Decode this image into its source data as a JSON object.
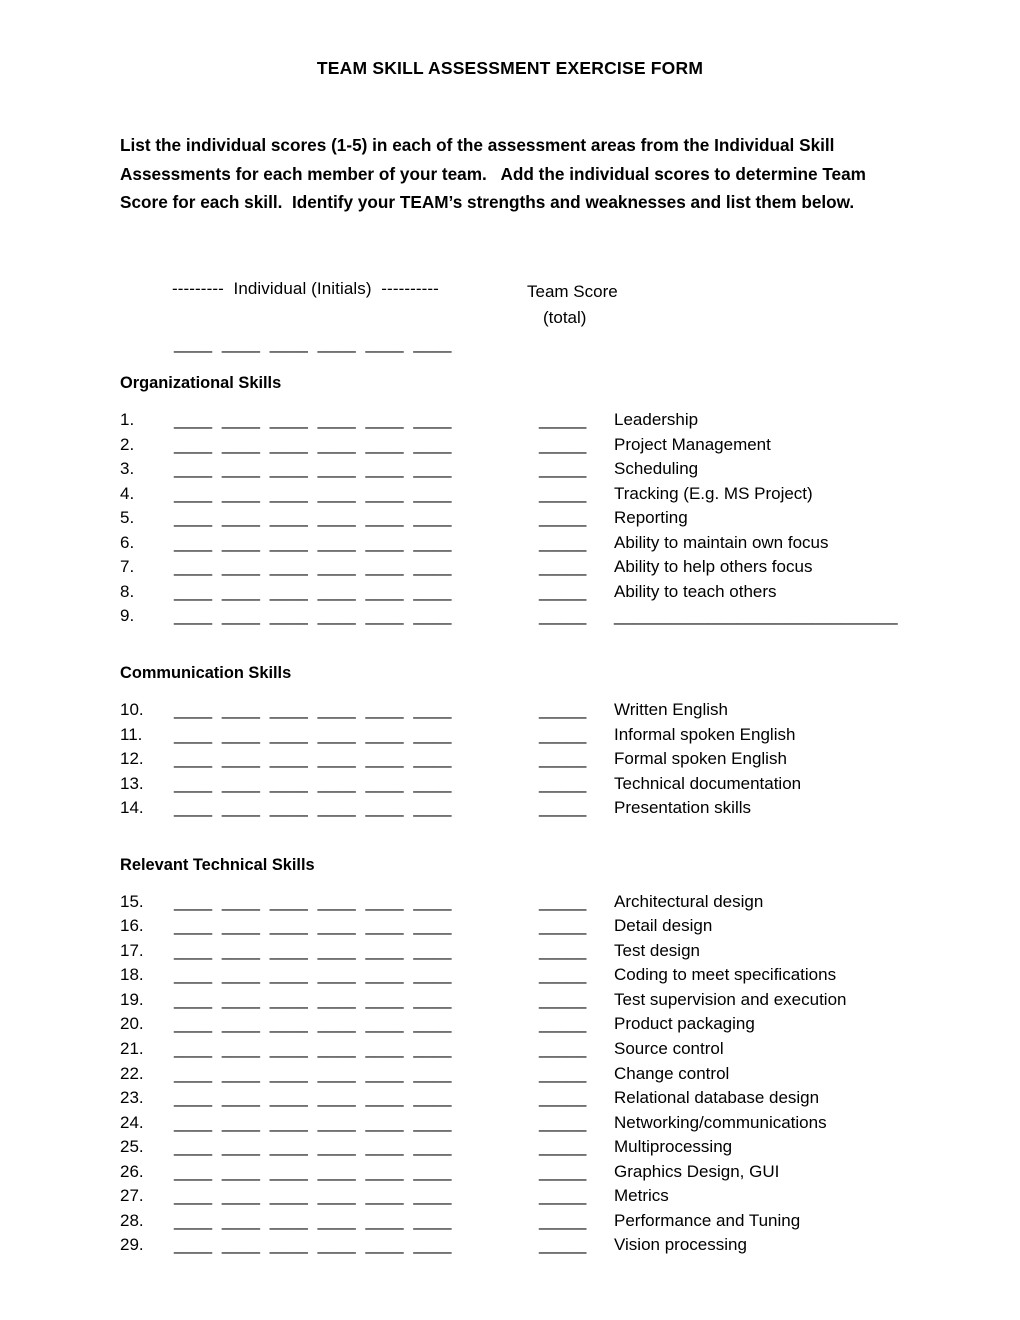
{
  "document": {
    "title": "TEAM SKILL ASSESSMENT EXERCISE FORM",
    "intro": "List the individual scores (1-5) in each of the assessment areas from the Individual Skill Assessments for each member of your team.   Add the individual scores to determine Team Score for each skill.  Identify your TEAM’s strengths and weaknesses and list them below."
  },
  "column_header": {
    "individual_label": "---------  Individual (Initials)  ----------",
    "team_score_line1": "Team Score",
    "team_score_line2": "(total)",
    "initials_blanks": "____  ____  ____  ____  ____  ____"
  },
  "blanks": {
    "individual_row": "____  ____  ____  ____  ____  ____",
    "team_score": "_____",
    "write_in_label": "______________________________"
  },
  "sections": [
    {
      "heading": "Organizational Skills",
      "rows": [
        {
          "number": "1.",
          "label": "Leadership"
        },
        {
          "number": "2.",
          "label": "Project Management"
        },
        {
          "number": "3.",
          "label": "Scheduling"
        },
        {
          "number": "4.",
          "label": "Tracking (E.g. MS Project)"
        },
        {
          "number": "5.",
          "label": "Reporting"
        },
        {
          "number": "6.",
          "label": "Ability to maintain own focus"
        },
        {
          "number": "7.",
          "label": "Ability to help others focus"
        },
        {
          "number": "8.",
          "label": "Ability to teach others"
        },
        {
          "number": "9.",
          "label": "______________________________"
        }
      ]
    },
    {
      "heading": "Communication Skills",
      "rows": [
        {
          "number": "10.",
          "label": "Written English"
        },
        {
          "number": "11.",
          "label": "Informal spoken English"
        },
        {
          "number": "12.",
          "label": "Formal spoken English"
        },
        {
          "number": "13.",
          "label": "Technical documentation"
        },
        {
          "number": "14.",
          "label": "Presentation skills"
        }
      ]
    },
    {
      "heading": "Relevant Technical Skills",
      "rows": [
        {
          "number": "15.",
          "label": "Architectural design"
        },
        {
          "number": "16.",
          "label": "Detail design"
        },
        {
          "number": "17.",
          "label": "Test design"
        },
        {
          "number": "18.",
          "label": "Coding to meet specifications"
        },
        {
          "number": "19.",
          "label": "Test supervision and execution"
        },
        {
          "number": "20.",
          "label": "Product packaging"
        },
        {
          "number": "21.",
          "label": "Source control"
        },
        {
          "number": "22.",
          "label": "Change control"
        },
        {
          "number": "23.",
          "label": "Relational database design"
        },
        {
          "number": "24.",
          "label": "Networking/communications"
        },
        {
          "number": "25.",
          "label": "Multiprocessing"
        },
        {
          "number": "26.",
          "label": "Graphics Design, GUI"
        },
        {
          "number": "27.",
          "label": "Metrics"
        },
        {
          "number": "28.",
          "label": "Performance and Tuning"
        },
        {
          "number": "29.",
          "label": "Vision processing"
        }
      ]
    }
  ],
  "colors": {
    "text": "#000000",
    "page_background": "#ffffff"
  }
}
